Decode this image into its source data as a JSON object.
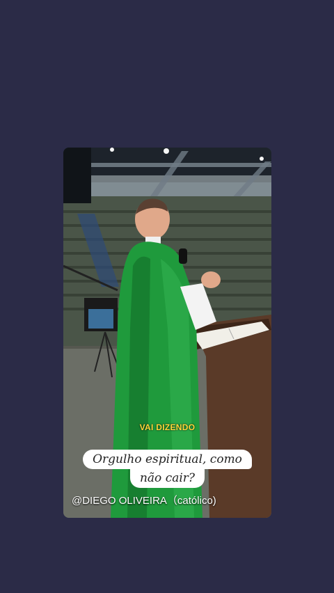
{
  "story": {
    "caption": "VAI DIZENDO",
    "title_line1": "Orgulho espiritual, como",
    "title_line2": "não cair?",
    "handle": "@DIEGO OLIVEIRA（católico)"
  },
  "colors": {
    "background": "#2b2b47",
    "vestment_green": "#1f9a3c",
    "caption_yellow": "#ffd83a"
  }
}
